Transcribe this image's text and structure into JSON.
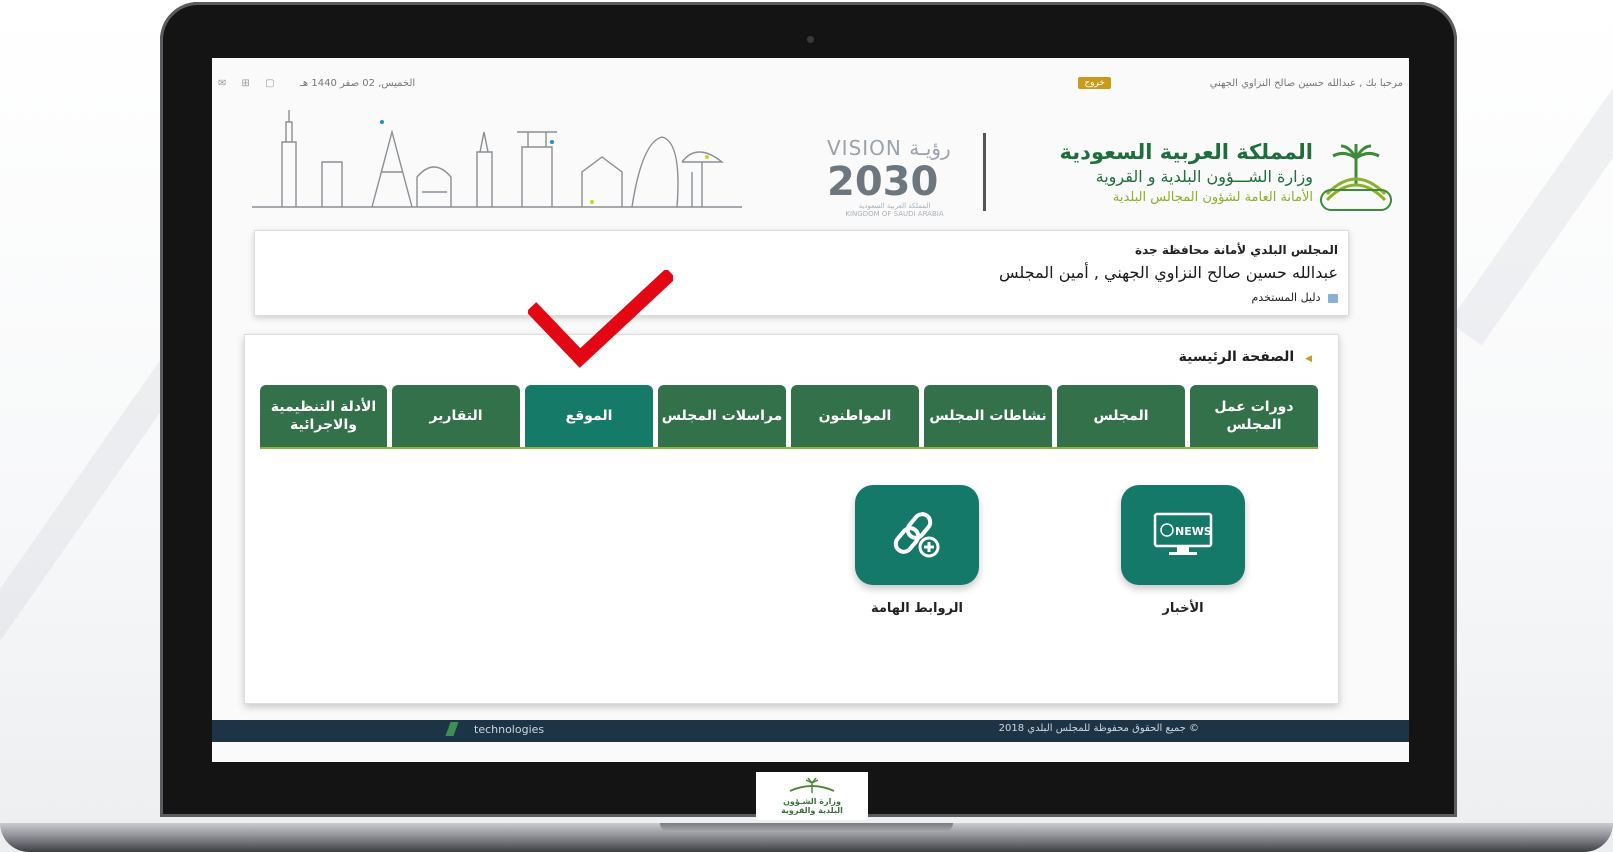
{
  "topbar": {
    "greeting": "مرحبا بك , عبدالله حسين صالح النزاوي الجهني",
    "logout": "خروج",
    "date": "الخميس, 02 صفر 1440 هـ",
    "tools": "✉ ⊞ ▢"
  },
  "header": {
    "kingdom": "المملكة العربية السعودية",
    "ministry": "وزارة الشـــؤون البلدية و القروية",
    "secretariat": "الأمانة العامة لشؤون المجالس البلدية",
    "vision_title": "VISION رؤيـة",
    "vision_year": "2030",
    "vision_sub_ar": "المملكة العربية السعودية",
    "vision_sub_en": "KINGDOM OF SAUDI ARABIA"
  },
  "council": {
    "name": "المجلس البلدي لأمانة محافظة جدة",
    "user": "عبدالله حسين صالح النزاوي الجهني , أمين المجلس",
    "guide": "دليل المستخدم"
  },
  "main": {
    "home_label": "الصفحة الرئيسية",
    "tabs": [
      {
        "label": "دورات عمل المجلس"
      },
      {
        "label": "المجلس"
      },
      {
        "label": "نشاطات المجلس"
      },
      {
        "label": "المواطنون"
      },
      {
        "label": "مراسلات المجلس"
      },
      {
        "label": "الموقع"
      },
      {
        "label": "التقارير"
      },
      {
        "label": "الأدلة التنظيمية والاجرائية"
      }
    ],
    "active_tab": "الموقع",
    "tiles": [
      {
        "label": "الأخبار",
        "icon": "news-monitor-icon",
        "icon_text": "NEWS"
      },
      {
        "label": "الروابط الهامة",
        "icon": "link-add-icon"
      }
    ]
  },
  "footer": {
    "tech": "technologies",
    "copyright": "© جميع الحقوق محفوظة للمجلس البلدي 2018"
  },
  "chin_logo": {
    "line1": "وزارة الشـؤون",
    "line2": "البلدية والقروية"
  },
  "colors": {
    "tab": "#33714a",
    "tab_active": "#157a68",
    "tile": "#15796a",
    "accent_green": "#1f6f3c",
    "checkmark": "#e30613"
  }
}
